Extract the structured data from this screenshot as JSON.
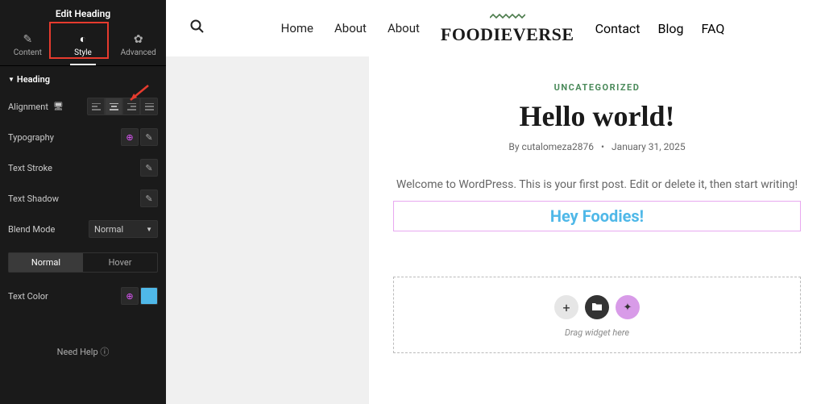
{
  "sidebar": {
    "title": "Edit Heading",
    "tabs": [
      {
        "id": "content",
        "label": "Content"
      },
      {
        "id": "style",
        "label": "Style"
      },
      {
        "id": "advanced",
        "label": "Advanced"
      }
    ],
    "section": "Heading",
    "controls": {
      "alignment": "Alignment",
      "typography": "Typography",
      "textStroke": "Text Stroke",
      "textShadow": "Text Shadow",
      "blendMode": "Blend Mode",
      "blendModeValue": "Normal",
      "textColor": "Text Color"
    },
    "stateTabs": {
      "normal": "Normal",
      "hover": "Hover"
    },
    "help": "Need Help"
  },
  "nav": {
    "left": [
      "Home",
      "About",
      "About"
    ],
    "right": [
      "Contact",
      "Blog",
      "FAQ"
    ],
    "brand": "FOODIEVERSE"
  },
  "post": {
    "category": "UNCATEGORIZED",
    "title": "Hello world!",
    "byPrefix": "By",
    "author": "cutalomeza2876",
    "date": "January 31, 2025",
    "welcome": "Welcome to WordPress. This is your first post. Edit or delete it, then start writing!"
  },
  "editor": {
    "heading": "Hey Foodies!",
    "dropLabel": "Drag widget here"
  },
  "colors": {
    "textColor": "#4fb8e8"
  }
}
